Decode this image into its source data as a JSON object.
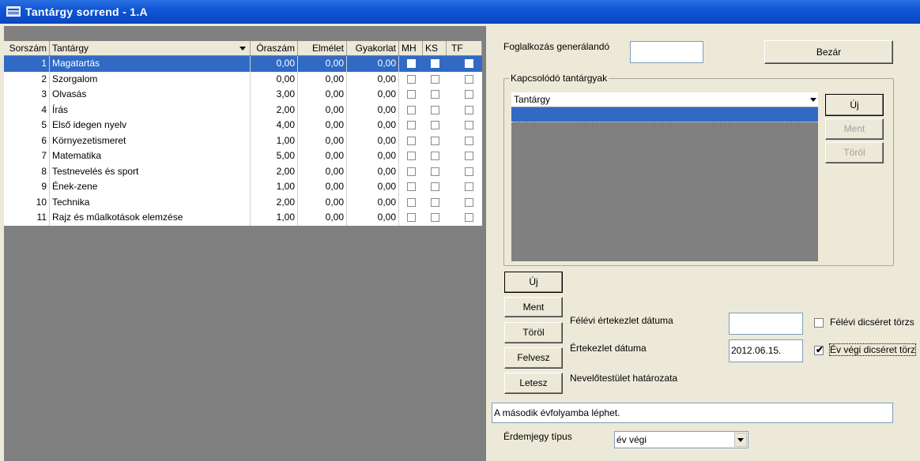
{
  "window": {
    "title": "Tantárgy sorrend - 1.A"
  },
  "grid": {
    "columns": [
      "Sorszám",
      "Tantárgy",
      "Óraszám",
      "Elmélet",
      "Gyakorlat",
      "MH",
      "KS",
      "TF"
    ],
    "rows": [
      {
        "n": "1",
        "name": "Magatartás",
        "ora": "0,00",
        "elm": "0,00",
        "gyak": "0,00",
        "selected": true
      },
      {
        "n": "2",
        "name": "Szorgalom",
        "ora": "0,00",
        "elm": "0,00",
        "gyak": "0,00"
      },
      {
        "n": "3",
        "name": "Olvasás",
        "ora": "3,00",
        "elm": "0,00",
        "gyak": "0,00"
      },
      {
        "n": "4",
        "name": "Írás",
        "ora": "2,00",
        "elm": "0,00",
        "gyak": "0,00"
      },
      {
        "n": "5",
        "name": "Első idegen nyelv",
        "ora": "4,00",
        "elm": "0,00",
        "gyak": "0,00"
      },
      {
        "n": "6",
        "name": "Környezetismeret",
        "ora": "1,00",
        "elm": "0,00",
        "gyak": "0,00"
      },
      {
        "n": "7",
        "name": "Matematika",
        "ora": "5,00",
        "elm": "0,00",
        "gyak": "0,00"
      },
      {
        "n": "8",
        "name": "Testnevelés és sport",
        "ora": "2,00",
        "elm": "0,00",
        "gyak": "0,00"
      },
      {
        "n": "9",
        "name": "Ének-zene",
        "ora": "1,00",
        "elm": "0,00",
        "gyak": "0,00"
      },
      {
        "n": "10",
        "name": "Technika",
        "ora": "2,00",
        "elm": "0,00",
        "gyak": "0,00"
      },
      {
        "n": "11",
        "name": "Rajz és műalkotások elemzése",
        "ora": "1,00",
        "elm": "0,00",
        "gyak": "0,00"
      }
    ]
  },
  "right": {
    "foglalkozas_label": "Foglalkozás generálandó",
    "foglalkozas_value": "",
    "bezar": "Bezár",
    "kapcsolodo_caption": "Kapcsolódó tantárgyak",
    "kapcsolodo_header": "Tantárgy",
    "kap_uj": "Új",
    "kap_ment": "Ment",
    "kap_torol": "Töröl",
    "uj": "Új",
    "ment": "Ment",
    "torol": "Töröl",
    "felvesz": "Felvesz",
    "letesz": "Letesz",
    "felevi_ertekezlet_label": "Félévi értekezlet dátuma",
    "felevi_ertekezlet_value": "",
    "ertekezlet_label": "Értekezlet dátuma",
    "ertekezlet_value": "2012.06.15.",
    "nevelotestulet_label": "Nevelőtestület határozata",
    "felevi_dicseret_label": "Félévi dicséret törzs",
    "felevi_dicseret_checked": false,
    "ev_vegi_dicseret_label": "Év végi dicséret törz",
    "ev_vegi_dicseret_checked": true,
    "hatarozat_value": "A második évfolyamba léphet.",
    "erdemjegy_label": "Érdemjegy típus",
    "erdemjegy_value": "év végi"
  },
  "colors": {
    "title_bar": "#0a47c0",
    "selection": "#316ac5",
    "grid_empty": "#808080"
  }
}
